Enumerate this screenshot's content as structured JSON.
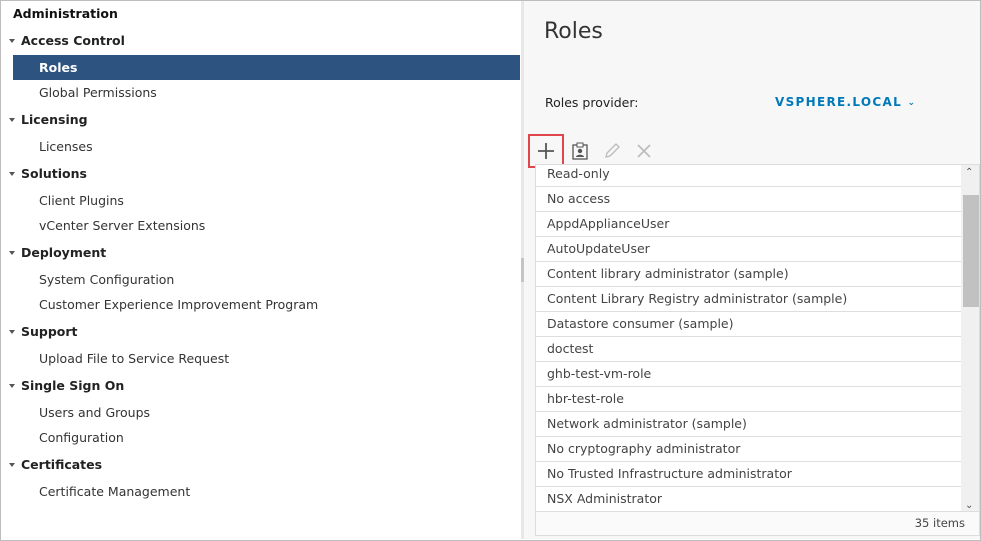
{
  "sidebar": {
    "title": "Administration",
    "groups": [
      {
        "label": "Access Control",
        "items": [
          "Roles",
          "Global Permissions"
        ]
      },
      {
        "label": "Licensing",
        "items": [
          "Licenses"
        ]
      },
      {
        "label": "Solutions",
        "items": [
          "Client Plugins",
          "vCenter Server Extensions"
        ]
      },
      {
        "label": "Deployment",
        "items": [
          "System Configuration",
          "Customer Experience Improvement Program"
        ]
      },
      {
        "label": "Support",
        "items": [
          "Upload File to Service Request"
        ]
      },
      {
        "label": "Single Sign On",
        "items": [
          "Users and Groups",
          "Configuration"
        ]
      },
      {
        "label": "Certificates",
        "items": [
          "Certificate Management"
        ]
      }
    ],
    "selected": "Roles"
  },
  "main": {
    "title": "Roles",
    "provider_label": "Roles provider:",
    "provider_value": "VSPHERE.LOCAL",
    "toolbar": {
      "add": "plus-icon",
      "clone": "clone-role-icon",
      "edit": "pencil-icon",
      "delete": "x-icon",
      "highlight_color": "#e0474c"
    },
    "roles": [
      "Read-only",
      "No access",
      "AppdApplianceUser",
      "AutoUpdateUser",
      "Content library administrator (sample)",
      "Content Library Registry administrator (sample)",
      "Datastore consumer (sample)",
      "doctest",
      "ghb-test-vm-role",
      "hbr-test-role",
      "Network administrator (sample)",
      "No cryptography administrator",
      "No Trusted Infrastructure administrator",
      "NSX Administrator"
    ],
    "item_count": "35 items"
  }
}
